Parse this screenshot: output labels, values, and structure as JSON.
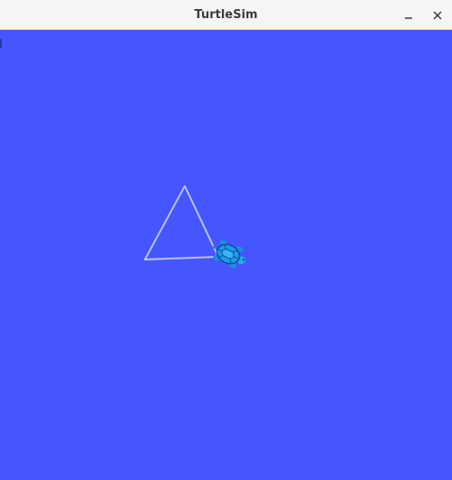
{
  "window": {
    "title": "TurtleSim",
    "controls": {
      "minimize_icon": "minimize-icon",
      "close_icon": "close-icon"
    }
  },
  "canvas": {
    "background_color": "#4556ff",
    "pen_color": "#b8bff3",
    "turtle_color": "#1e9be8",
    "turtle_icon": "turtle-icon"
  }
}
